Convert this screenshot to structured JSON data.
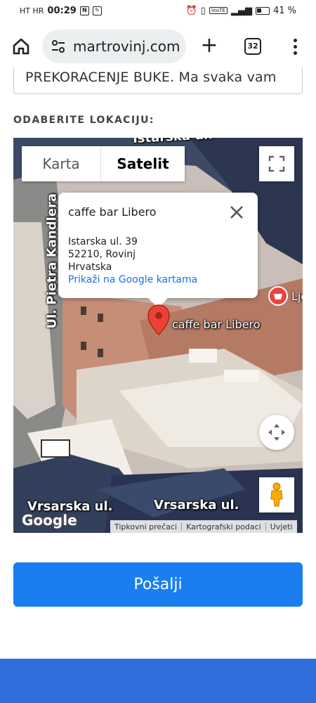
{
  "status_bar": {
    "carrier": "HT HR",
    "time": "00:29",
    "battery": "41 %"
  },
  "browser": {
    "url": "martrovinj.com",
    "tab_count": "32"
  },
  "form": {
    "textarea_value": "PREKORACENJE BUKE. Ma svaka vam",
    "location_label": "ODABERITE LOKACIJU:",
    "submit_label": "Pošalji"
  },
  "map": {
    "type_options": [
      "Karta",
      "Satelit"
    ],
    "selected_type": "Satelit",
    "info_window": {
      "title": "caffe bar Libero",
      "address_line1": "Istarska ul. 39",
      "address_line2": "52210, Rovinj",
      "address_line3": "Hrvatska",
      "link": "Prikaži na Google kartama"
    },
    "marker_label": "caffe bar Libero",
    "poi_label": "Lje",
    "streets": {
      "top": "Istarska ul.",
      "left": "Ul. Pietra Kandlera",
      "bottom_left": "Vrsarska ul.",
      "bottom_right": "Vrsarska ul."
    },
    "google_logo": "Google",
    "footer_links": [
      "Tipkovni prečaci",
      "Kartografski podaci",
      "Uvjeti"
    ],
    "marker_color": "#ea4335"
  }
}
